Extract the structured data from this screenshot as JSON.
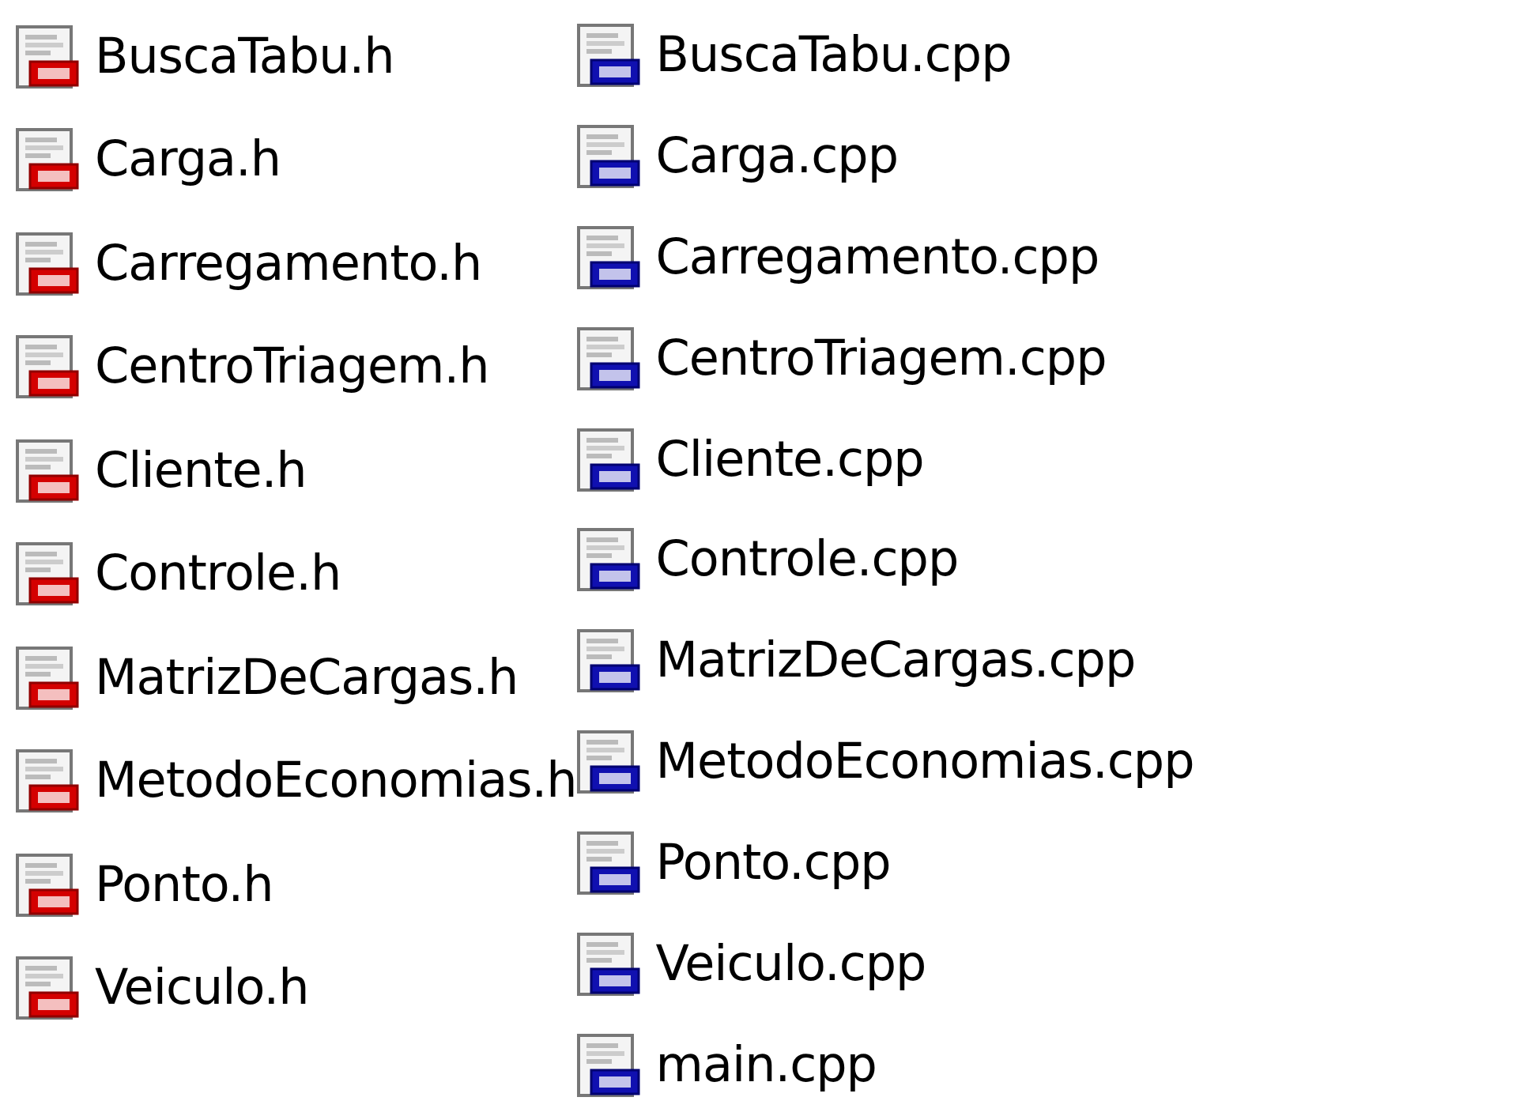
{
  "columns": [
    {
      "files": [
        {
          "name": "BuscaTabu.h",
          "kind": "header"
        },
        {
          "name": "Carga.h",
          "kind": "header"
        },
        {
          "name": "Carregamento.h",
          "kind": "header"
        },
        {
          "name": "CentroTriagem.h",
          "kind": "header"
        },
        {
          "name": "Cliente.h",
          "kind": "header"
        },
        {
          "name": "Controle.h",
          "kind": "header"
        },
        {
          "name": "MatrizDeCargas.h",
          "kind": "header"
        },
        {
          "name": "MetodoEconomias.h",
          "kind": "header"
        },
        {
          "name": "Ponto.h",
          "kind": "header"
        },
        {
          "name": "Veiculo.h",
          "kind": "header"
        }
      ]
    },
    {
      "files": [
        {
          "name": "BuscaTabu.cpp",
          "kind": "source"
        },
        {
          "name": "Carga.cpp",
          "kind": "source"
        },
        {
          "name": "Carregamento.cpp",
          "kind": "source"
        },
        {
          "name": "CentroTriagem.cpp",
          "kind": "source"
        },
        {
          "name": "Cliente.cpp",
          "kind": "source"
        },
        {
          "name": "Controle.cpp",
          "kind": "source"
        },
        {
          "name": "MatrizDeCargas.cpp",
          "kind": "source"
        },
        {
          "name": "MetodoEconomias.cpp",
          "kind": "source"
        },
        {
          "name": "Ponto.cpp",
          "kind": "source"
        },
        {
          "name": "Veiculo.cpp",
          "kind": "source"
        },
        {
          "name": "main.cpp",
          "kind": "source"
        }
      ]
    }
  ]
}
